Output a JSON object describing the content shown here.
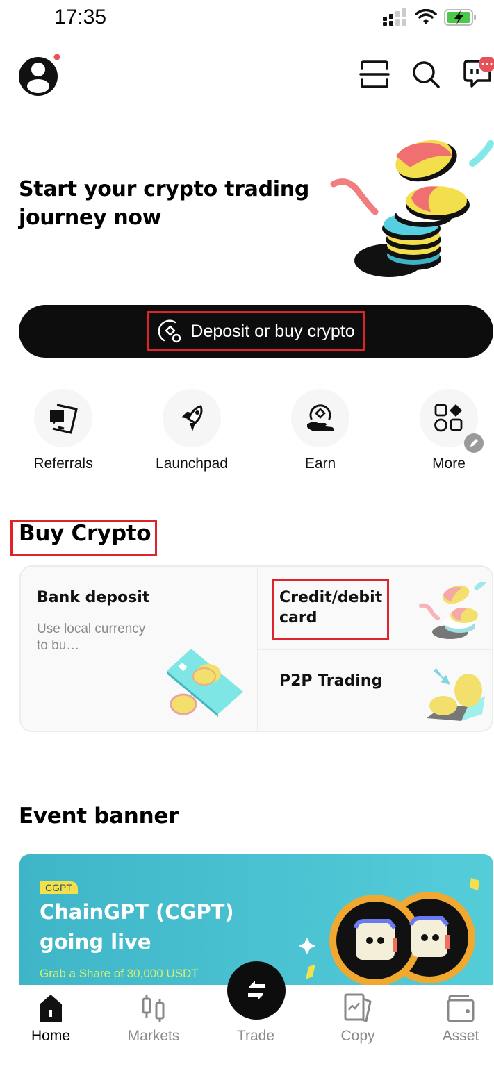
{
  "status_bar": {
    "time": "17:35",
    "icons": [
      "signal-icon",
      "wifi-icon",
      "battery-charging-icon"
    ]
  },
  "header": {
    "avatar_icon": "user-avatar-icon",
    "notification_dot": true,
    "right_icons": [
      "scan-icon",
      "search-icon",
      "messages-icon"
    ]
  },
  "hero": {
    "title": "Start your crypto trading journey now",
    "cta_label": "Deposit or buy crypto",
    "cta_icon": "deposit-coin-icon"
  },
  "quick_actions": [
    {
      "label": "Referrals",
      "icon": "referrals-icon"
    },
    {
      "label": "Launchpad",
      "icon": "rocket-icon"
    },
    {
      "label": "Earn",
      "icon": "earn-hand-icon"
    },
    {
      "label": "More",
      "icon": "grid-more-icon",
      "badge": "edit-pencil-icon"
    }
  ],
  "buy_crypto": {
    "title": "Buy Crypto",
    "options": [
      {
        "title": "Bank deposit",
        "subtitle": "Use local currency to bu…"
      },
      {
        "title": "Credit/debit card"
      },
      {
        "title": "P2P Trading"
      }
    ]
  },
  "event_banner": {
    "title": "Event banner",
    "tag": "CGPT",
    "headline_line1": "ChainGPT (CGPT)",
    "headline_line2": "going live",
    "subline": "Grab a Share of 30,000 USDT"
  },
  "bottom_nav": {
    "items": [
      {
        "label": "Home",
        "icon": "home-icon",
        "active": true
      },
      {
        "label": "Markets",
        "icon": "candlestick-icon",
        "active": false
      },
      {
        "label": "Trade",
        "icon": "swap-arrows-icon",
        "active": false
      },
      {
        "label": "Copy",
        "icon": "copy-trading-icon",
        "active": false
      },
      {
        "label": "Asset",
        "icon": "wallet-icon",
        "active": false
      }
    ]
  },
  "colors": {
    "accent_dark": "#0d0d0d",
    "highlight_red": "#e0222a",
    "banner_teal": "#4cc3d2",
    "tag_yellow": "#f3e04b",
    "notification_red": "#e5525a"
  }
}
